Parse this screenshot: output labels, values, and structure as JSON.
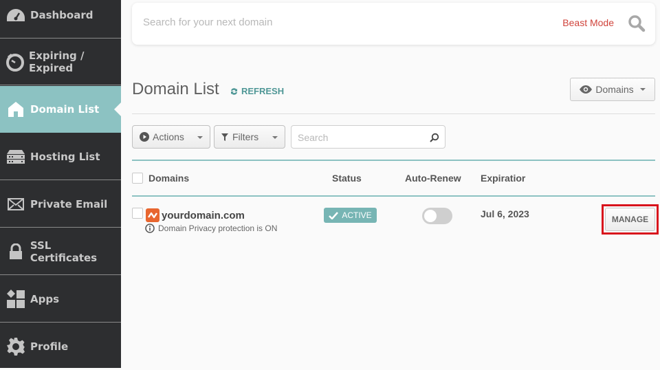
{
  "sidebar": {
    "items": [
      {
        "label": "Dashboard",
        "icon": "dashboard-gauge-icon",
        "active": false
      },
      {
        "label": "Expiring / Expired",
        "icon": "stopwatch-icon",
        "active": false
      },
      {
        "label": "Domain List",
        "icon": "home-icon",
        "active": true
      },
      {
        "label": "Hosting List",
        "icon": "server-icon",
        "active": false
      },
      {
        "label": "Private Email",
        "icon": "envelope-icon",
        "active": false
      },
      {
        "label": "SSL Certificates",
        "icon": "lock-icon",
        "active": false
      },
      {
        "label": "Apps",
        "icon": "apps-grid-icon",
        "active": false
      },
      {
        "label": "Profile",
        "icon": "gear-icon",
        "active": false
      }
    ]
  },
  "search": {
    "placeholder": "Search for your next domain",
    "beast_mode_label": "Beast Mode",
    "icon": "search-icon"
  },
  "page": {
    "title": "Domain List",
    "refresh_label": "REFRESH",
    "view_dropdown_label": "Domains"
  },
  "toolbar": {
    "actions_label": "Actions",
    "filters_label": "Filters",
    "search_placeholder": "Search"
  },
  "table": {
    "columns": [
      "Domains",
      "Status",
      "Auto-Renew",
      "Expiratior"
    ],
    "rows": [
      {
        "domain": "yourdomain.com",
        "privacy_note": "Domain Privacy protection is ON",
        "status": "ACTIVE",
        "auto_renew": false,
        "expiration": "Jul 6, 2023",
        "action_label": "MANAGE"
      }
    ]
  },
  "colors": {
    "sidebar_bg": "#2d2e30",
    "accent_teal": "#8cc2c2",
    "beast_mode_red": "#d0433b",
    "highlight_red": "#d8131c",
    "brand_orange": "#e8662f"
  }
}
